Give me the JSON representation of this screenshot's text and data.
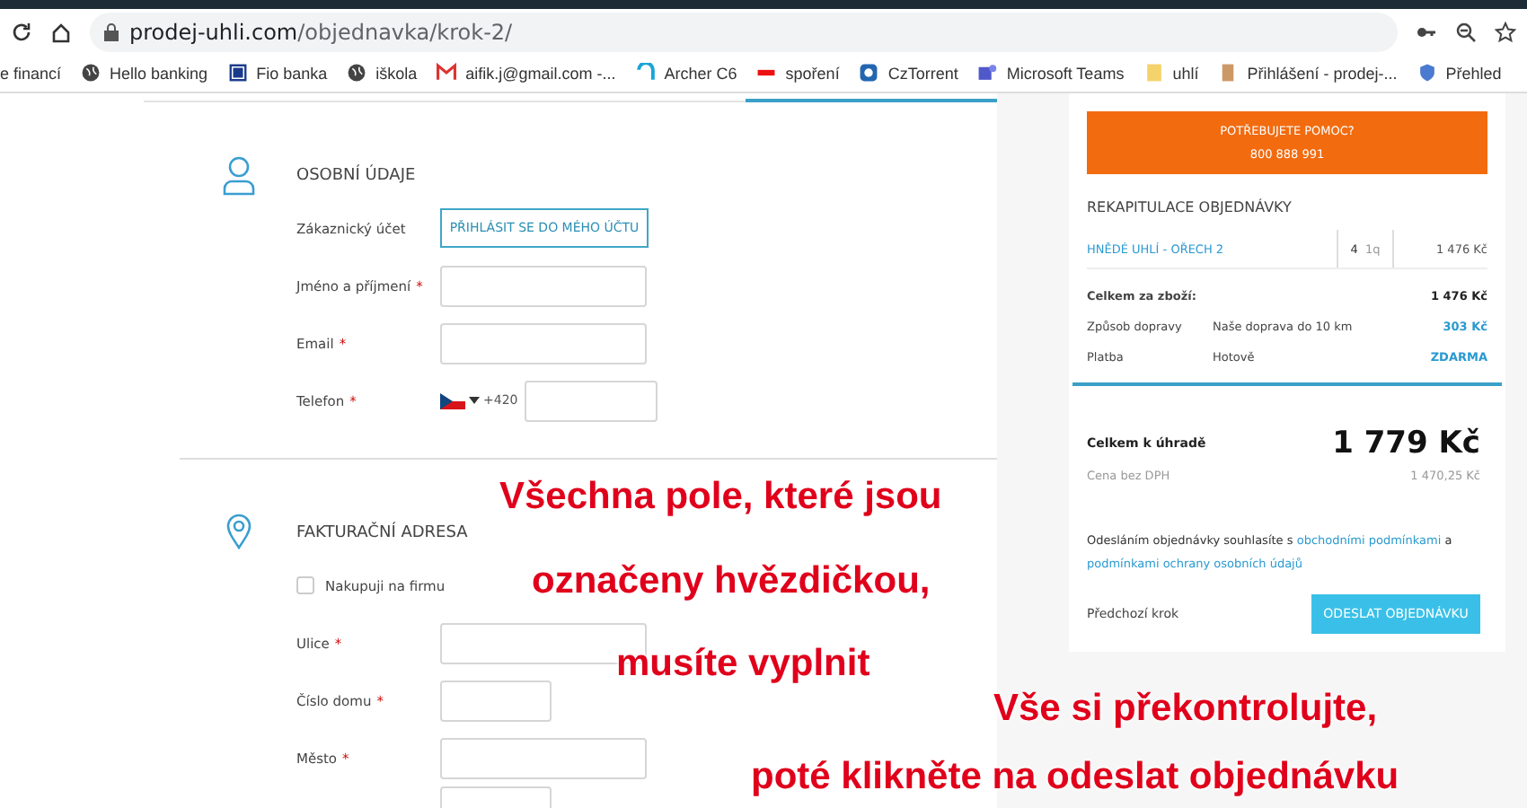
{
  "browser": {
    "address_domain": "prodej-uhli.com",
    "address_path": "/objednavka/krok-2/",
    "bookmarks": [
      "e financí",
      "Hello banking",
      "Fio banka",
      "iškola",
      "aifik.j@gmail.com -...",
      "Archer C6",
      "spoření",
      "CzTorrent",
      "Microsoft Teams",
      "uhlí",
      "Přihlášení - prodej-...",
      "Přehled"
    ]
  },
  "sections": [
    {
      "title": "OSOBNÍ ÚDAJE",
      "rows": [
        {
          "kind": "button",
          "label": "Zákaznický účet",
          "button": "PŘIHLÁSIT SE DO MÉHO ÚČTU"
        },
        {
          "kind": "input",
          "label": "Jméno a příjmení",
          "required_mark": "*"
        },
        {
          "kind": "input",
          "label": "Email",
          "required_mark": "*"
        },
        {
          "kind": "phone",
          "label": "Telefon",
          "required_mark": "*",
          "prefix": "+420"
        }
      ]
    },
    {
      "title": "FAKTURAČNÍ ADRESA",
      "rows": [
        {
          "kind": "checkbox",
          "label": "Nakupuji na firmu",
          "checked": false
        },
        {
          "kind": "input",
          "label": "Ulice",
          "required_mark": "*"
        },
        {
          "kind": "input_short",
          "label": "Číslo domu",
          "required_mark": "*"
        },
        {
          "kind": "input",
          "label": "Město",
          "required_mark": "*"
        },
        {
          "kind": "input_partial"
        }
      ]
    }
  ],
  "help": {
    "title": "POTŘEBUJETE POMOC?",
    "phone": "800 888 991"
  },
  "summary": {
    "title": "REKAPITULACE OBJEDNÁVKY",
    "item": {
      "name": "HNĚDÉ UHLÍ - OŘECH 2",
      "qty": "4",
      "unit": "1q",
      "price": "1 476 Kč"
    },
    "rows": [
      {
        "label": "Celkem za zboží:",
        "detail": "",
        "value": "1 476 Kč",
        "kind": "bold"
      },
      {
        "label": "Způsob dopravy",
        "detail": "Naše doprava do 10 km",
        "value": "303 Kč",
        "kind": "accent"
      },
      {
        "label": "Platba",
        "detail": "Hotově",
        "value": "ZDARMA",
        "kind": "accent"
      }
    ],
    "total_label": "Celkem k úhradě",
    "total": "1 779 Kč",
    "net_label": "Cena bez DPH",
    "net": "1 470,25 Kč",
    "terms_before": "Odesláním objednávky souhlasíte s",
    "terms_link1": "obchodními podmínkami",
    "terms_and": "a",
    "terms_link2": "podmínkami ochrany osobních údajů",
    "back": "Předchozí krok",
    "submit": "ODESLAT OBJEDNÁVKU"
  },
  "annotations": [
    "Všechna pole, které jsou",
    "označeny hvězdičkou,",
    "musíte vyplnit",
    "Vše si překontrolujte,",
    "poté klikněte na odeslat objednávku"
  ]
}
